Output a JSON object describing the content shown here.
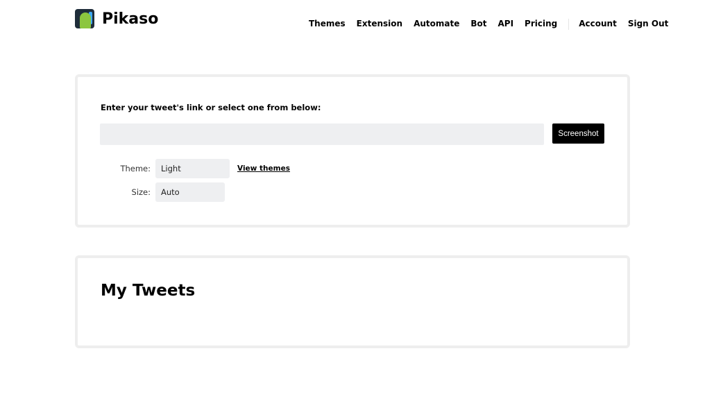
{
  "brand": {
    "name": "Pikaso"
  },
  "nav": {
    "items": [
      "Themes",
      "Extension",
      "Automate",
      "Bot",
      "API",
      "Pricing"
    ],
    "account": "Account",
    "sign_out": "Sign Out"
  },
  "form": {
    "label": "Enter your tweet's link or select one from below:",
    "url_value": "",
    "button": "Screenshot",
    "theme_label": "Theme:",
    "theme_value": "Light",
    "view_themes": "View themes",
    "size_label": "Size:",
    "size_value": "Auto"
  },
  "tweets": {
    "title": "My Tweets"
  }
}
